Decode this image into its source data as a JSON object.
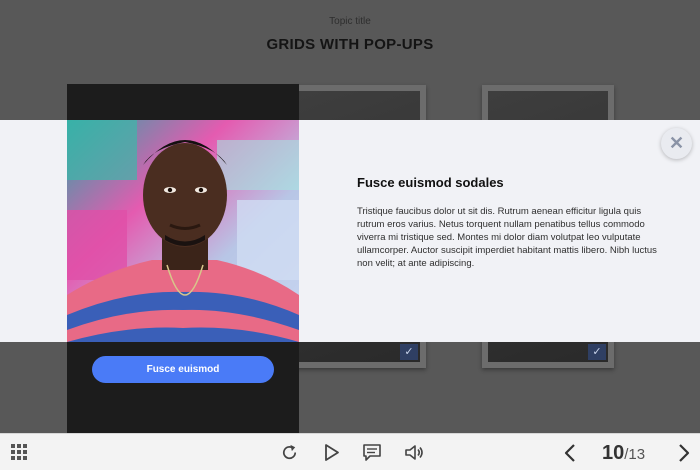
{
  "slide": {
    "topic_label": "Topic title",
    "heading": "GRIDS WITH POP-UPS"
  },
  "popup": {
    "title": "Fusce euismod sodales",
    "body": "Tristique faucibus dolor ut sit dis. Rutrum aenean efficitur ligula quis rutrum eros varius. Netus torquent nullam penatibus tellus commodo viverra mi tristique sed. Montes mi dolor diam volutpat leo vulputate ullamcorper. Auctor suscipit imperdiet habitant mattis libero. Nibh luctus non velit; at ante adipiscing.",
    "close_icon": "close-icon",
    "photo": "portrait-photo"
  },
  "side_panel": {
    "button_label": "Fusce euismod"
  },
  "player": {
    "menu_icon": "grid-menu-icon",
    "controls": [
      "replay-icon",
      "play-icon",
      "comment-icon",
      "volume-icon"
    ],
    "current_page": "10",
    "total_pages": "/13"
  },
  "colors": {
    "accent": "#4a7bf7",
    "overlay": "#585858",
    "panel": "#1c1c1c"
  }
}
